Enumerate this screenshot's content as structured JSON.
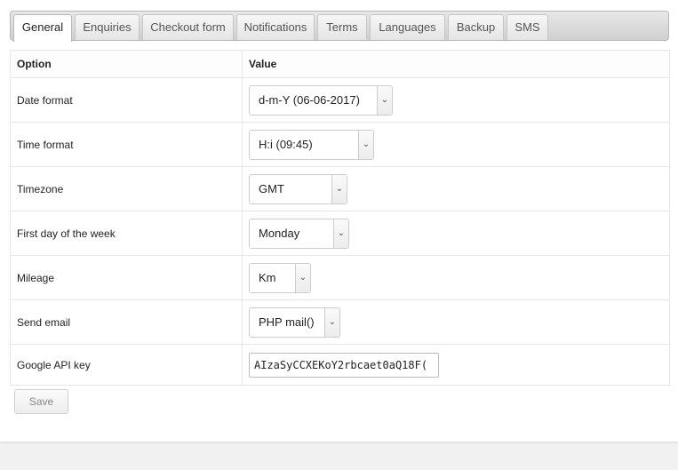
{
  "tabs": [
    {
      "label": "General",
      "active": true
    },
    {
      "label": "Enquiries"
    },
    {
      "label": "Checkout form"
    },
    {
      "label": "Notifications"
    },
    {
      "label": "Terms"
    },
    {
      "label": "Languages"
    },
    {
      "label": "Backup"
    },
    {
      "label": "SMS"
    }
  ],
  "table": {
    "col_option": "Option",
    "col_value": "Value",
    "rows": [
      {
        "label": "Date format",
        "value": "d-m-Y (06-06-2017)"
      },
      {
        "label": "Time format",
        "value": "H:i (09:45)"
      },
      {
        "label": "Timezone",
        "value": "GMT"
      },
      {
        "label": "First day of the week",
        "value": "Monday"
      },
      {
        "label": "Mileage",
        "value": "Km"
      },
      {
        "label": "Send email",
        "value": "PHP mail()"
      },
      {
        "label": "Google API key",
        "value": "AIzaSyCCXEKoY2rbcaet0aQ18F("
      }
    ]
  },
  "save_label": "Save",
  "icons": {
    "dropdown": "chevron-down-icon"
  }
}
